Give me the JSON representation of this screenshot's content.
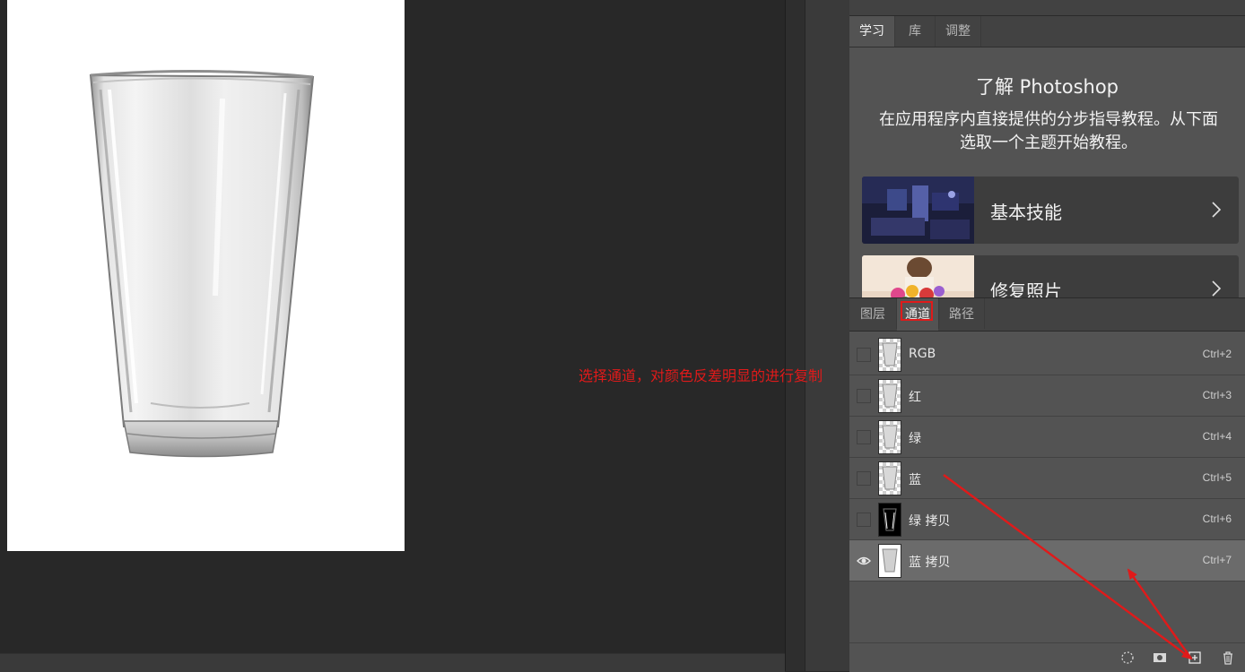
{
  "learn_panel": {
    "tabs": [
      "学习",
      "库",
      "调整"
    ],
    "title": "了解 Photoshop",
    "description": "在应用程序内直接提供的分步指导教程。从下面选取一个主题开始教程。",
    "tutorials": [
      {
        "label": "基本技能",
        "icon": "chevron-right-icon"
      },
      {
        "label": "修复照片",
        "icon": "chevron-right-icon"
      }
    ]
  },
  "channels_panel": {
    "tabs": [
      "图层",
      "通道",
      "路径"
    ],
    "active_tab": "通道",
    "channels": [
      {
        "name": "RGB",
        "shortcut": "Ctrl+2",
        "visible": false
      },
      {
        "name": "红",
        "shortcut": "Ctrl+3",
        "visible": false
      },
      {
        "name": "绿",
        "shortcut": "Ctrl+4",
        "visible": false
      },
      {
        "name": "蓝",
        "shortcut": "Ctrl+5",
        "visible": false
      },
      {
        "name": "绿 拷贝",
        "shortcut": "Ctrl+6",
        "visible": false
      },
      {
        "name": "蓝 拷贝",
        "shortcut": "Ctrl+7",
        "visible": true,
        "selected": true
      }
    ],
    "footer_icons": [
      "load-selection-icon",
      "save-selection-icon",
      "new-channel-icon",
      "delete-channel-icon"
    ]
  },
  "annotation": {
    "text": "选择通道，对颜色反差明显的进行复制",
    "color": "#e01a1a"
  },
  "colors": {
    "panel_bg": "#535353",
    "canvas_bg": "#282828",
    "highlight_red": "#e01a1a"
  }
}
